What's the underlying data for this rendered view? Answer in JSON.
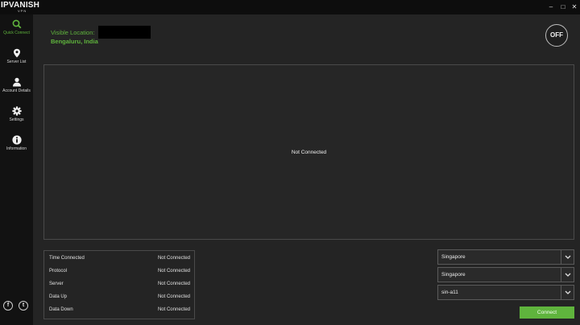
{
  "app": {
    "logo_ip": "IP",
    "logo_main": "VANISH",
    "logo_sub": "VPN",
    "window_controls": {
      "minimize": "–",
      "maximize": "□",
      "close": "✕"
    }
  },
  "sidebar": {
    "items": [
      {
        "label": "Quick Connect",
        "icon": "search-icon",
        "active": true
      },
      {
        "label": "Server List",
        "icon": "location-pin-icon",
        "active": false
      },
      {
        "label": "Account Details",
        "icon": "user-icon",
        "active": false
      },
      {
        "label": "Settings",
        "icon": "gear-icon",
        "active": false
      },
      {
        "label": "Information",
        "icon": "info-icon",
        "active": false
      }
    ],
    "social": [
      {
        "icon": "facebook-icon",
        "glyph": "f"
      },
      {
        "icon": "twitter-icon",
        "glyph": "t"
      }
    ]
  },
  "location": {
    "label": "Visible Location:",
    "value": "Bengaluru, India"
  },
  "toggle": {
    "label": "OFF"
  },
  "graph": {
    "status": "Not Connected"
  },
  "stats": [
    {
      "label": "Time Connected",
      "value": "Not Connected"
    },
    {
      "label": "Protocol",
      "value": "Not Connected"
    },
    {
      "label": "Server",
      "value": "Not Connected"
    },
    {
      "label": "Data Up",
      "value": "Not Connected"
    },
    {
      "label": "Data Down",
      "value": "Not Connected"
    }
  ],
  "selects": {
    "country": "Singapore",
    "city": "Singapore",
    "server": "sin-a11"
  },
  "connect_label": "Connect",
  "colors": {
    "accent": "#5fb43d",
    "background": "#242424",
    "sidebar": "#121212"
  }
}
